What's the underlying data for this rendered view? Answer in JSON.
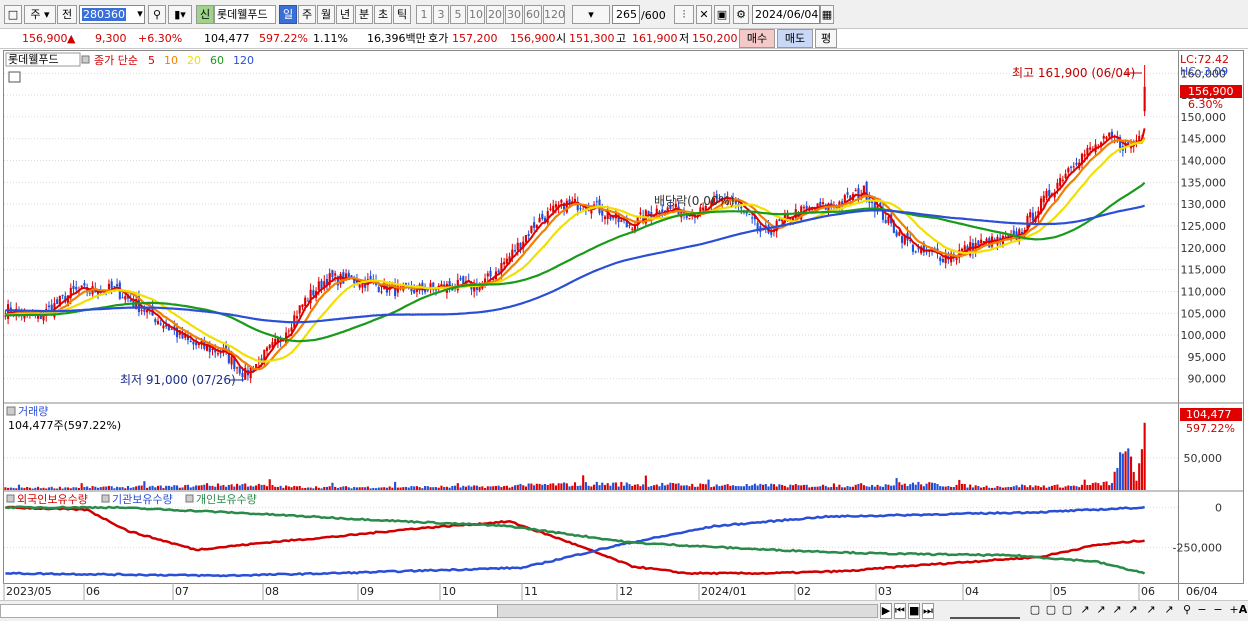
{
  "toolbar": {
    "layout_icon": "layout-icon",
    "period_type": "주",
    "prev_label": "전",
    "code": "280360",
    "chart_icon": "candle-icon",
    "sin_label": "신",
    "stock_name": "롯데웰푸드",
    "periods": [
      {
        "label": "일",
        "selected": true
      },
      {
        "label": "주",
        "selected": false
      },
      {
        "label": "월",
        "selected": false
      },
      {
        "label": "년",
        "selected": false
      },
      {
        "label": "분",
        "selected": false
      },
      {
        "label": "초",
        "selected": false
      },
      {
        "label": "틱",
        "selected": false
      }
    ],
    "intervals": [
      "1",
      "3",
      "5",
      "10",
      "20",
      "30",
      "60",
      "120"
    ],
    "count": "265",
    "count_max": "/600",
    "date": "2024/06/04"
  },
  "quote": {
    "price": "156,900",
    "arrow": "▲",
    "change": "9,300",
    "change_pct": "+6.30%",
    "volume": "104,477",
    "volume_ratio": "597.22%",
    "turnover": "1.11%",
    "amount": "16,396백만",
    "ask_label": "호가",
    "ask1": "157,200",
    "ask2": "156,900",
    "open_label": "시",
    "open": "151,300",
    "high_label": "고",
    "high": "161,900",
    "low_label": "저",
    "low": "150,200",
    "buy_label": "매수",
    "sell_label": "매도",
    "avg_label": "평"
  },
  "price_panel": {
    "title": "롯데웰푸드",
    "ma_label": "종가 단순",
    "ma_periods": [
      {
        "label": "5",
        "color": "#e00000"
      },
      {
        "label": "10",
        "color": "#f08000"
      },
      {
        "label": "20",
        "color": "#f0e000"
      },
      {
        "label": "60",
        "color": "#1a9a1a"
      },
      {
        "label": "120",
        "color": "#2a4fd6"
      }
    ],
    "lc": "LC:72.42",
    "hc": "HC:-3.09",
    "last_price": "156,900",
    "last_pct": "6.30%",
    "high_annotation": "최고 161,900 (06/04)",
    "low_annotation": "최저 91,000 (07/26)",
    "dividend_annotation": "배당락(0.00%)",
    "y_ticks": [
      "160,000",
      "155,000",
      "150,000",
      "145,000",
      "140,000",
      "135,000",
      "130,000",
      "125,000",
      "120,000",
      "115,000",
      "110,000",
      "105,000",
      "100,000",
      "95,000",
      "90,000"
    ]
  },
  "volume_panel": {
    "title": "거래량",
    "info": "104,477주(597.22%)",
    "last_value": "104,477",
    "last_pct": "597.22%",
    "y_ticks": [
      "50,000"
    ]
  },
  "holding_panel": {
    "series": [
      {
        "label": "외국인보유수량",
        "color": "#d00000"
      },
      {
        "label": "기관보유수량",
        "color": "#2a4fd6"
      },
      {
        "label": "개인보유수량",
        "color": "#2a8a4a"
      }
    ],
    "y_ticks": [
      "0",
      "-250,000"
    ]
  },
  "x_axis": {
    "labels": [
      "2023/05",
      "06",
      "07",
      "08",
      "09",
      "10",
      "11",
      "12",
      "2024/01",
      "02",
      "03",
      "04",
      "05",
      "06"
    ],
    "last": "06/04"
  },
  "chart_data": {
    "type": "line",
    "x_start": "2023/05",
    "x_end": "2024/06/04",
    "price_anchors": [
      [
        0,
        106000
      ],
      [
        12,
        104000
      ],
      [
        25,
        110000
      ],
      [
        40,
        110500
      ],
      [
        55,
        104000
      ],
      [
        68,
        98000
      ],
      [
        80,
        96000
      ],
      [
        88,
        91000
      ],
      [
        100,
        98500
      ],
      [
        110,
        108000
      ],
      [
        118,
        113000
      ],
      [
        130,
        112500
      ],
      [
        145,
        110000
      ],
      [
        160,
        111000
      ],
      [
        175,
        111500
      ],
      [
        185,
        118000
      ],
      [
        195,
        126000
      ],
      [
        205,
        130000
      ],
      [
        215,
        130000
      ],
      [
        228,
        125000
      ],
      [
        240,
        129000
      ],
      [
        255,
        128000
      ],
      [
        265,
        132000
      ],
      [
        278,
        123000
      ],
      [
        290,
        128000
      ],
      [
        305,
        130000
      ],
      [
        315,
        133000
      ],
      [
        325,
        125000
      ],
      [
        335,
        119000
      ],
      [
        345,
        118000
      ],
      [
        358,
        121000
      ],
      [
        370,
        122000
      ],
      [
        380,
        130000
      ],
      [
        392,
        140000
      ],
      [
        405,
        145000
      ],
      [
        412,
        143000
      ],
      [
        418,
        147000
      ]
    ],
    "volume_anchors": [
      [
        0,
        3000
      ],
      [
        30,
        4000
      ],
      [
        60,
        5000
      ],
      [
        88,
        8000
      ],
      [
        100,
        5000
      ],
      [
        120,
        4000
      ],
      [
        180,
        5000
      ],
      [
        200,
        8000
      ],
      [
        220,
        9000
      ],
      [
        260,
        7000
      ],
      [
        300,
        6000
      ],
      [
        335,
        9000
      ],
      [
        360,
        5000
      ],
      [
        395,
        6000
      ],
      [
        406,
        11000
      ],
      [
        411,
        60000
      ],
      [
        415,
        12000
      ],
      [
        418,
        104477
      ]
    ],
    "foreign_anchors": [
      [
        0,
        0
      ],
      [
        30,
        -5000
      ],
      [
        45,
        -50000
      ],
      [
        70,
        -90000
      ],
      [
        95,
        -75000
      ],
      [
        125,
        -60000
      ],
      [
        150,
        -45000
      ],
      [
        185,
        -30000
      ],
      [
        205,
        -70000
      ],
      [
        230,
        -125000
      ],
      [
        250,
        -140000
      ],
      [
        280,
        -140000
      ],
      [
        310,
        -135000
      ],
      [
        330,
        -125000
      ],
      [
        355,
        -115000
      ],
      [
        380,
        -105000
      ],
      [
        400,
        -80000
      ],
      [
        418,
        -70000
      ]
    ],
    "institution_anchors": [
      [
        0,
        -140000
      ],
      [
        80,
        -145000
      ],
      [
        120,
        -140000
      ],
      [
        190,
        -128000
      ],
      [
        225,
        -80000
      ],
      [
        260,
        -40000
      ],
      [
        300,
        -20000
      ],
      [
        340,
        -15000
      ],
      [
        380,
        -10000
      ],
      [
        418,
        0
      ]
    ],
    "individual_anchors": [
      [
        0,
        0
      ],
      [
        40,
        0
      ],
      [
        80,
        -10000
      ],
      [
        130,
        -25000
      ],
      [
        185,
        -40000
      ],
      [
        230,
        -75000
      ],
      [
        280,
        -90000
      ],
      [
        320,
        -98000
      ],
      [
        370,
        -102000
      ],
      [
        400,
        -115000
      ],
      [
        418,
        -140000
      ]
    ]
  }
}
